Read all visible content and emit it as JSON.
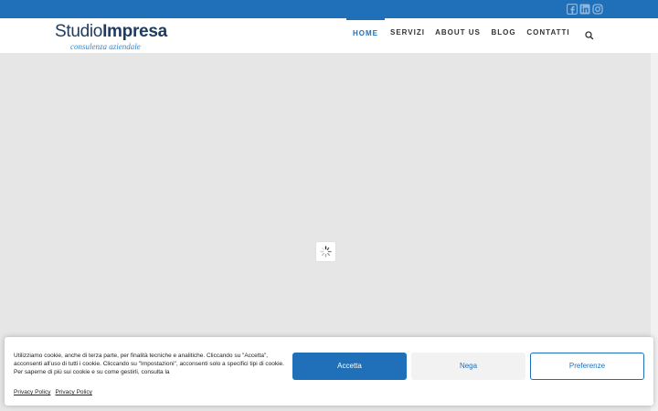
{
  "colors": {
    "brand_blue": "#1f6fb9",
    "logo_dark": "#1e3a5f",
    "background": "#e6e6e6"
  },
  "social": [
    {
      "icon": "facebook-square-icon"
    },
    {
      "icon": "linkedin-icon"
    },
    {
      "icon": "instagram-icon"
    }
  ],
  "logo": {
    "part1": "Studio",
    "part2": "Impresa",
    "tagline": "consulenza aziendale"
  },
  "menu": {
    "items": [
      {
        "label": "HOME",
        "active": true
      },
      {
        "label": "SERVIZI",
        "active": false
      },
      {
        "label": "ABOUT US",
        "active": false
      },
      {
        "label": "BLOG",
        "active": false
      },
      {
        "label": "CONTATTI",
        "active": false
      }
    ],
    "search_icon": "search-icon"
  },
  "loader": {
    "icon": "spinner-icon"
  },
  "cookie": {
    "text": "Utilizziamo cookie, anche di terza parte, per finalità tecniche e analitiche. Cliccando su \"Accetta\", acconsenti all'uso di tutti i cookie. Cliccando su \"Impostazioni\", acconsenti solo a specifici tipi di cookie. Per saperne di più sui cookie e su come gestirli, consulta la",
    "links": [
      "Privacy Policy",
      "Privacy Policy"
    ],
    "accept_label": "Accetta",
    "deny_label": "Nega",
    "preferences_label": "Preferenze"
  }
}
